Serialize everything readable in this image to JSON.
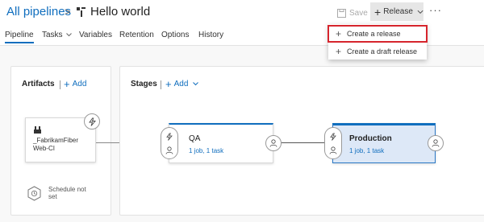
{
  "header": {
    "breadcrumb": "All pipelines",
    "separator": ">",
    "title": "Hello world",
    "save_label": "Save",
    "release_label": "Release",
    "more_label": "···"
  },
  "tabs": [
    {
      "label": "Pipeline"
    },
    {
      "label": "Tasks"
    },
    {
      "label": "Variables"
    },
    {
      "label": "Retention"
    },
    {
      "label": "Options"
    },
    {
      "label": "History"
    }
  ],
  "release_menu": {
    "items": [
      {
        "label": "Create a release"
      },
      {
        "label": "Create a draft release"
      }
    ]
  },
  "artifacts": {
    "title": "Artifacts",
    "add_label": "Add",
    "card_name": "_FabrikamFiber Web-CI",
    "schedule_label": "Schedule not set"
  },
  "stages": {
    "title": "Stages",
    "add_label": "Add",
    "items": [
      {
        "name": "QA",
        "detail": "1 job, 1 task"
      },
      {
        "name": "Production",
        "detail": "1 job, 1 task"
      }
    ]
  },
  "colors": {
    "accent": "#106ebe",
    "highlight_border": "#d6252d",
    "selected_stage_bg": "#dde8f7"
  }
}
